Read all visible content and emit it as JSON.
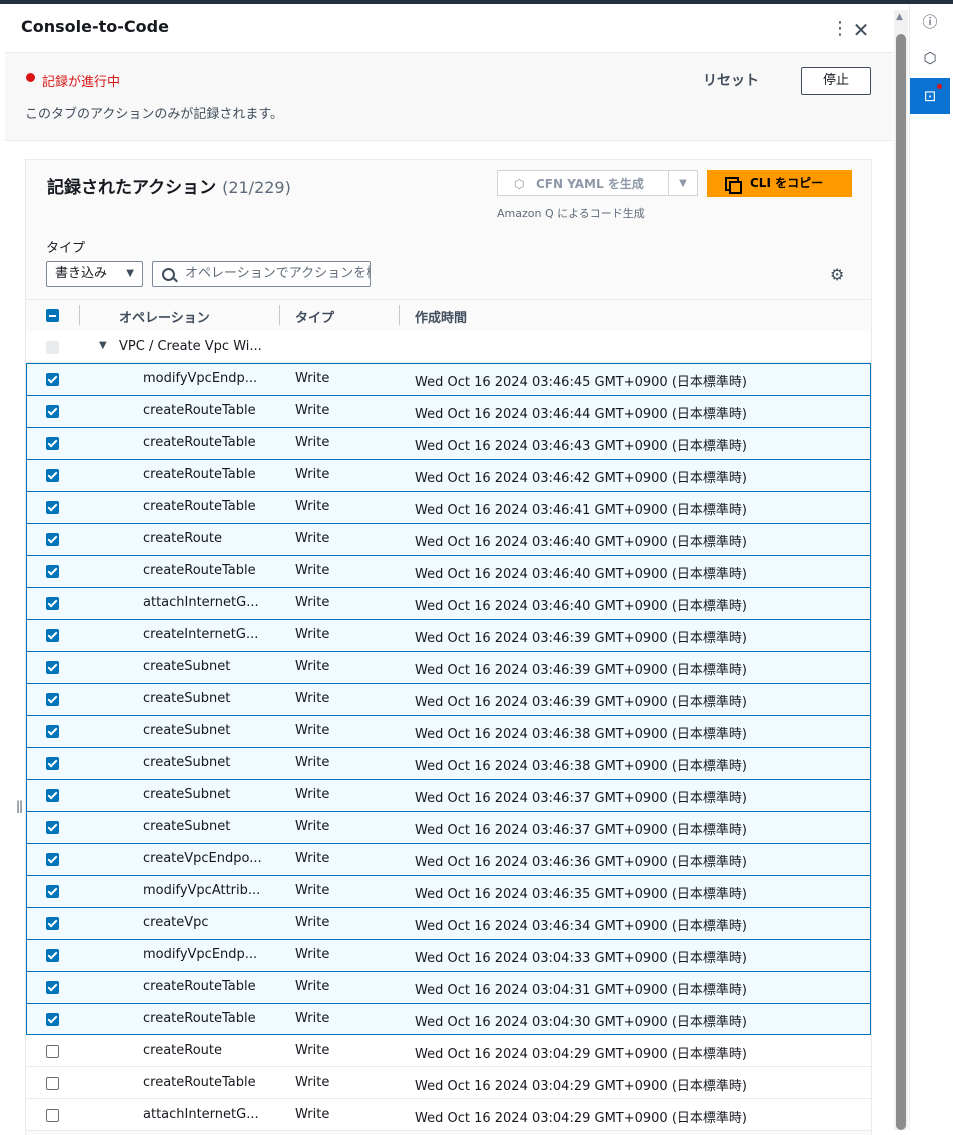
{
  "panel": {
    "title": "Console-to-Code",
    "kebab_glyph": "⋮",
    "close_glyph": "✕"
  },
  "status": {
    "recording_text": "記録が進行中",
    "description": "このタブのアクションのみが記録されます。",
    "reset_label": "リセット",
    "stop_label": "停止"
  },
  "actions_header": {
    "title": "記録されたアクション",
    "count": "(21/229)",
    "cfn_button_label": "CFN YAML を生成",
    "cli_button_label": "CLI をコピー",
    "amazonq_text": "Amazon Q によるコード生成"
  },
  "filter": {
    "type_label": "タイプ",
    "type_value": "書き込み",
    "search_placeholder": "オペレーションでアクションを検索"
  },
  "table": {
    "columns": [
      "オペレーション",
      "タイプ",
      "作成時間"
    ],
    "group_label": "VPC / Create Vpc Wi...",
    "rows": [
      {
        "op": "modifyVpcEndp...",
        "type": "Write",
        "time": "Wed Oct 16 2024 03:46:45 GMT+0900 (日本標準時)",
        "checked": true
      },
      {
        "op": "createRouteTable",
        "type": "Write",
        "time": "Wed Oct 16 2024 03:46:44 GMT+0900 (日本標準時)",
        "checked": true
      },
      {
        "op": "createRouteTable",
        "type": "Write",
        "time": "Wed Oct 16 2024 03:46:43 GMT+0900 (日本標準時)",
        "checked": true
      },
      {
        "op": "createRouteTable",
        "type": "Write",
        "time": "Wed Oct 16 2024 03:46:42 GMT+0900 (日本標準時)",
        "checked": true
      },
      {
        "op": "createRouteTable",
        "type": "Write",
        "time": "Wed Oct 16 2024 03:46:41 GMT+0900 (日本標準時)",
        "checked": true
      },
      {
        "op": "createRoute",
        "type": "Write",
        "time": "Wed Oct 16 2024 03:46:40 GMT+0900 (日本標準時)",
        "checked": true
      },
      {
        "op": "createRouteTable",
        "type": "Write",
        "time": "Wed Oct 16 2024 03:46:40 GMT+0900 (日本標準時)",
        "checked": true
      },
      {
        "op": "attachInternetG...",
        "type": "Write",
        "time": "Wed Oct 16 2024 03:46:40 GMT+0900 (日本標準時)",
        "checked": true
      },
      {
        "op": "createInternetG...",
        "type": "Write",
        "time": "Wed Oct 16 2024 03:46:39 GMT+0900 (日本標準時)",
        "checked": true
      },
      {
        "op": "createSubnet",
        "type": "Write",
        "time": "Wed Oct 16 2024 03:46:39 GMT+0900 (日本標準時)",
        "checked": true
      },
      {
        "op": "createSubnet",
        "type": "Write",
        "time": "Wed Oct 16 2024 03:46:39 GMT+0900 (日本標準時)",
        "checked": true
      },
      {
        "op": "createSubnet",
        "type": "Write",
        "time": "Wed Oct 16 2024 03:46:38 GMT+0900 (日本標準時)",
        "checked": true
      },
      {
        "op": "createSubnet",
        "type": "Write",
        "time": "Wed Oct 16 2024 03:46:38 GMT+0900 (日本標準時)",
        "checked": true
      },
      {
        "op": "createSubnet",
        "type": "Write",
        "time": "Wed Oct 16 2024 03:46:37 GMT+0900 (日本標準時)",
        "checked": true
      },
      {
        "op": "createSubnet",
        "type": "Write",
        "time": "Wed Oct 16 2024 03:46:37 GMT+0900 (日本標準時)",
        "checked": true
      },
      {
        "op": "createVpcEndpo...",
        "type": "Write",
        "time": "Wed Oct 16 2024 03:46:36 GMT+0900 (日本標準時)",
        "checked": true
      },
      {
        "op": "modifyVpcAttrib...",
        "type": "Write",
        "time": "Wed Oct 16 2024 03:46:35 GMT+0900 (日本標準時)",
        "checked": true
      },
      {
        "op": "createVpc",
        "type": "Write",
        "time": "Wed Oct 16 2024 03:46:34 GMT+0900 (日本標準時)",
        "checked": true
      },
      {
        "op": "modifyVpcEndp...",
        "type": "Write",
        "time": "Wed Oct 16 2024 03:04:33 GMT+0900 (日本標準時)",
        "checked": true
      },
      {
        "op": "createRouteTable",
        "type": "Write",
        "time": "Wed Oct 16 2024 03:04:31 GMT+0900 (日本標準時)",
        "checked": true
      },
      {
        "op": "createRouteTable",
        "type": "Write",
        "time": "Wed Oct 16 2024 03:04:30 GMT+0900 (日本標準時)",
        "checked": true
      },
      {
        "op": "createRoute",
        "type": "Write",
        "time": "Wed Oct 16 2024 03:04:29 GMT+0900 (日本標準時)",
        "checked": false
      },
      {
        "op": "createRouteTable",
        "type": "Write",
        "time": "Wed Oct 16 2024 03:04:29 GMT+0900 (日本標準時)",
        "checked": false
      },
      {
        "op": "attachInternetG...",
        "type": "Write",
        "time": "Wed Oct 16 2024 03:04:29 GMT+0900 (日本標準時)",
        "checked": false
      }
    ]
  },
  "sidebar_icons": [
    "info-icon",
    "hexagon-icon",
    "console-to-code-icon"
  ],
  "colors": {
    "accent": "#0073bb",
    "primary_button": "#ff9900",
    "recording": "#d91515",
    "active_tab": "#0972d3"
  }
}
